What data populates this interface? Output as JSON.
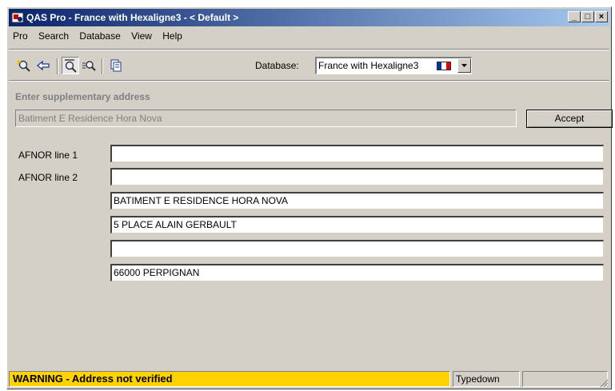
{
  "window": {
    "title": "QAS Pro - France with Hexaligne3 - < Default >",
    "controls": [
      "_",
      "□",
      "×"
    ]
  },
  "menu": [
    "Pro",
    "Search",
    "Database",
    "View",
    "Help"
  ],
  "toolbar": {
    "icons": [
      "new-search-icon",
      "back-arrow-icon",
      "typedown-search-icon",
      "refine-search-icon",
      "copy-icon"
    ],
    "database_label": "Database:",
    "database_value": "France with Hexaligne3",
    "flag_colors": [
      "#0032a0",
      "#ffffff",
      "#e1000f"
    ]
  },
  "supplementary": {
    "label": "Enter supplementary address",
    "value": "Batiment E Residence Hora Nova",
    "accept_label": "Accept"
  },
  "address": {
    "labels": [
      "AFNOR line 1",
      "AFNOR line 2"
    ],
    "lines": [
      "",
      "",
      "BATIMENT E RESIDENCE HORA NOVA",
      "5 PLACE ALAIN GERBAULT",
      "",
      "66000 PERPIGNAN"
    ]
  },
  "status": {
    "warning": "WARNING - Address not verified",
    "warning_color": "#ffd200",
    "mode": "Typedown",
    "extra": ""
  }
}
